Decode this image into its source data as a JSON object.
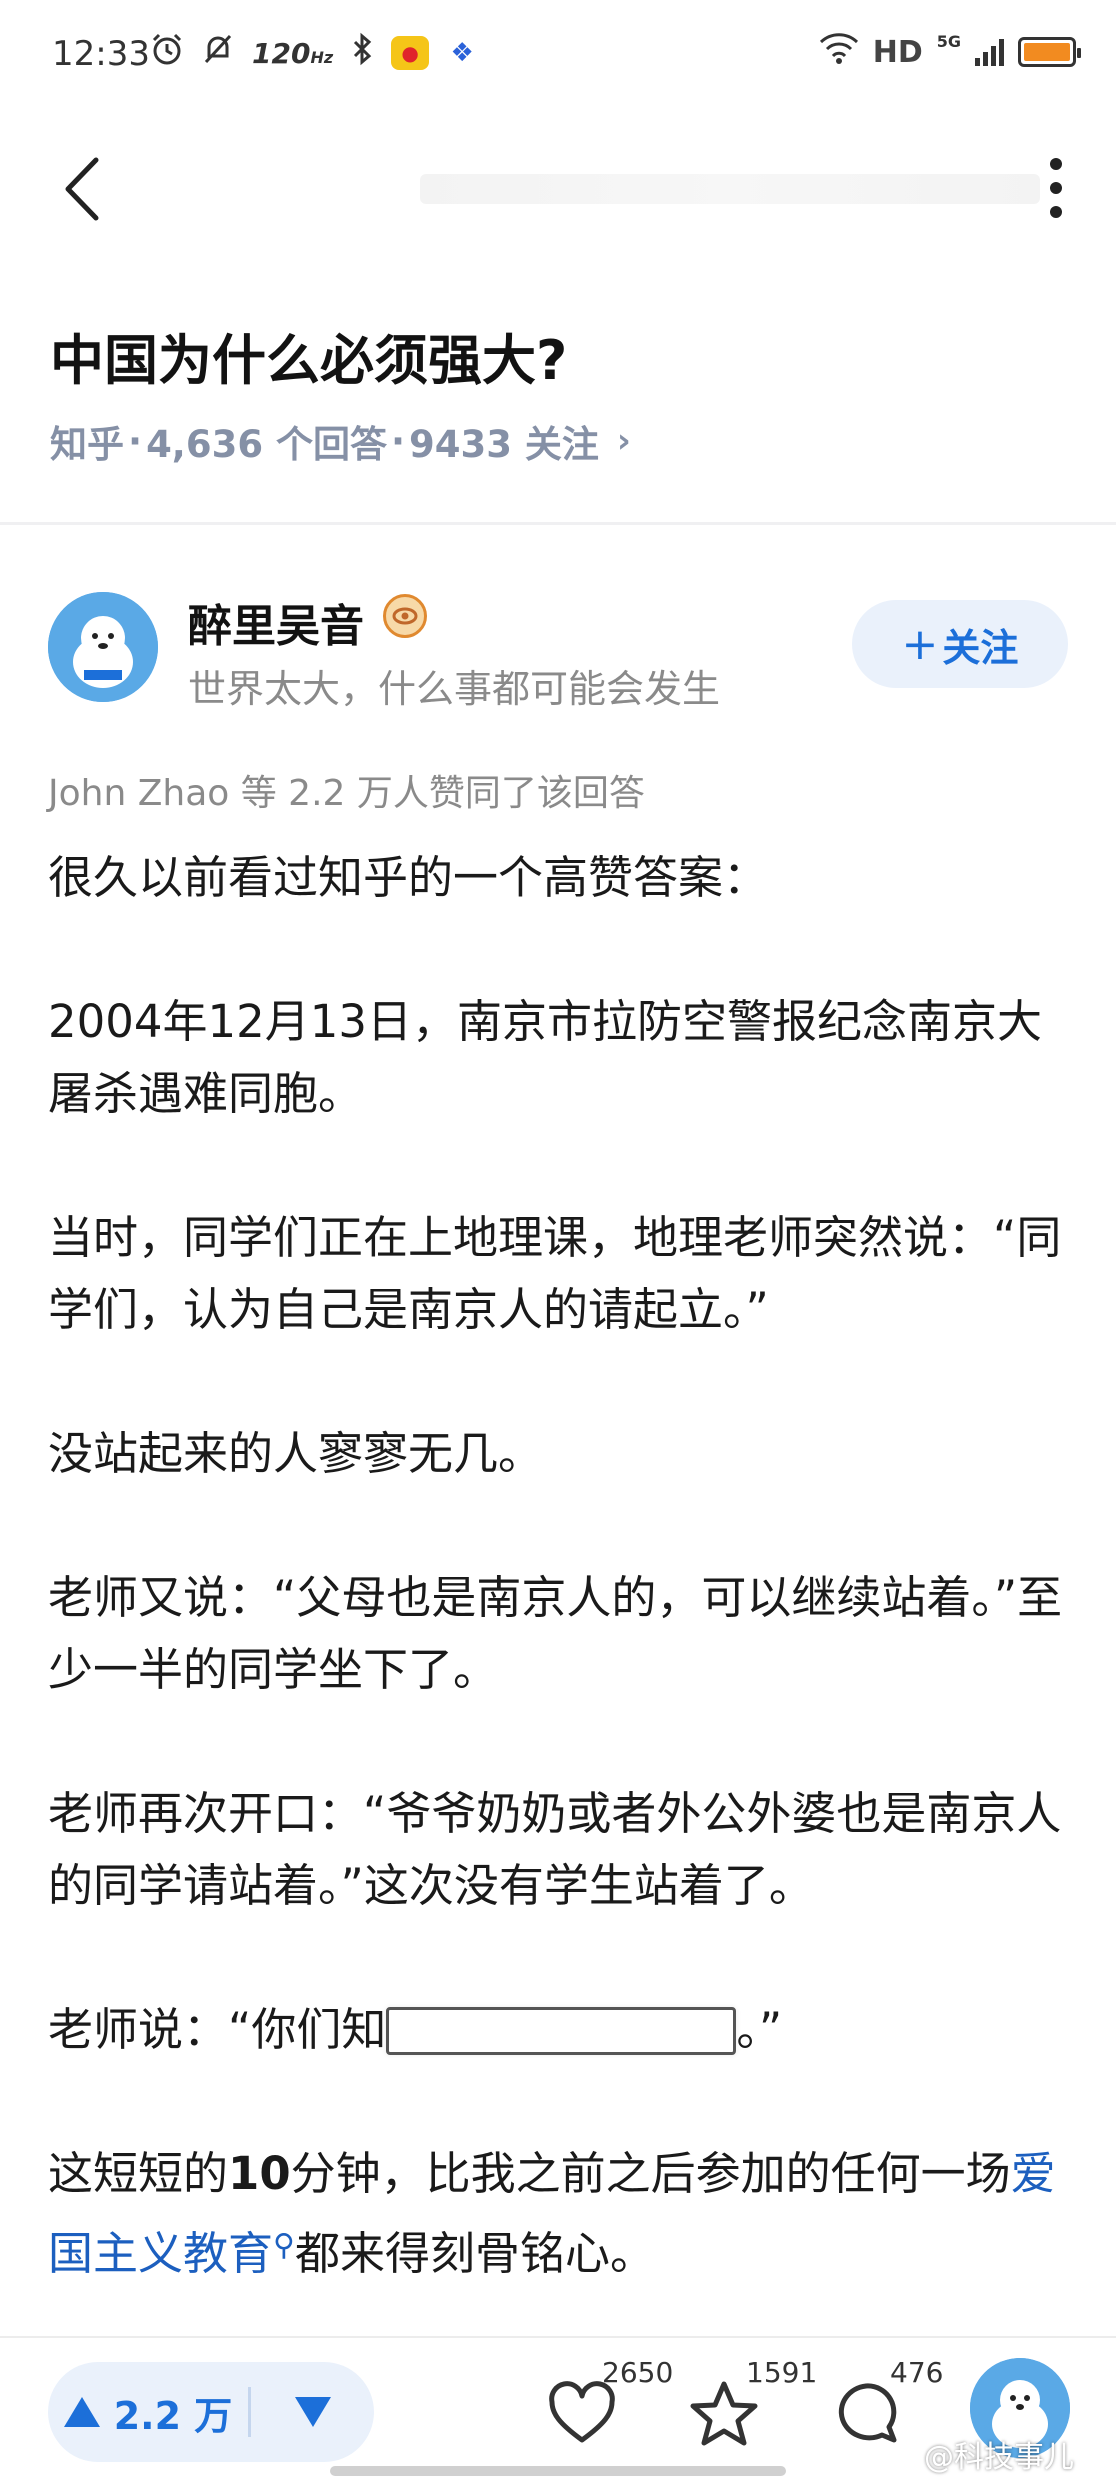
{
  "status_bar": {
    "time": "12:33",
    "refresh_rate": "120",
    "refresh_unit": "Hz",
    "network_type": "HD",
    "signal_type": "5G",
    "battery_color": "#f28b20"
  },
  "question": {
    "title": "中国为什么必须强大?",
    "source": "知乎",
    "answers": "4,636 个回答",
    "followers": "9433 关注",
    "dot": "·"
  },
  "author": {
    "name": "醉里吴音",
    "bio": "世界太大，什么事都可能会发生",
    "follow_label": "关注",
    "follow_plus": "+"
  },
  "answer": {
    "voters_line": "John Zhao 等 2.2 万人赞同了该回答",
    "paragraphs": [
      "很久以前看过知乎的一个高赞答案：",
      "2004年12月13日，南京市拉防空警报纪念南京大屠杀遇难同胞。",
      "当时，同学们正在上地理课，地理老师突然说：“同学们，认为自己是南京人的请起立。”",
      "没站起来的人寥寥无几。",
      "老师又说：“父母也是南京人的，可以继续站着。”至少一半的同学坐下了。",
      "老师再次开口：“爷爷奶奶或者外公外婆也是南京人的同学请站着。”这次没有学生站着了。"
    ],
    "teacher_quote_start": "老师说：“你们知",
    "teacher_quote_end": "。”",
    "last_para_start": "这短短的",
    "last_para_bold": "10",
    "last_para_mid": "分钟，比我之前之后参加的任何一场",
    "topic_link": "爱国主义教育",
    "last_para_end": "都来得刻骨铭心。"
  },
  "bottom_bar": {
    "upvote_count": "2.2 万",
    "like_count": "2650",
    "favorite_count": "1591",
    "comment_count": "476",
    "watermark": "@科技事儿",
    "accent_color": "#1c6fd9"
  }
}
